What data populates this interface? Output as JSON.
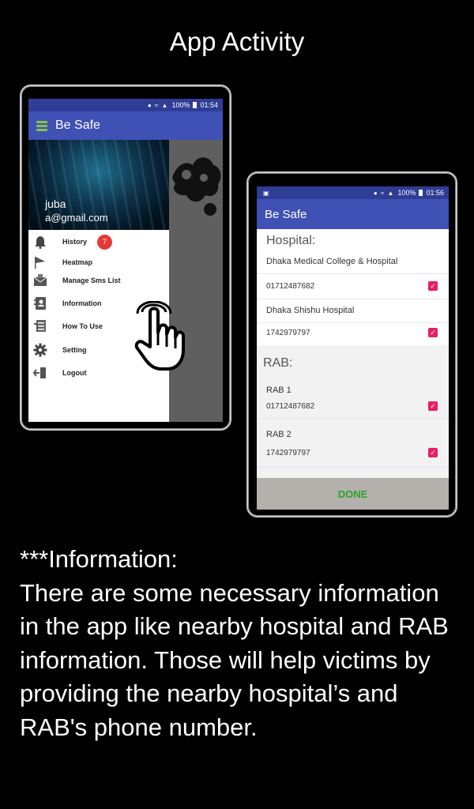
{
  "page": {
    "title": "App Activity"
  },
  "left_device": {
    "status": {
      "time": "01:54",
      "battery": "100%"
    },
    "appbar": {
      "title": "Be Safe",
      "menu_icon": "hamburger-icon",
      "menu_icon_color": "#8bc34a"
    },
    "drawer": {
      "user_name": "juba",
      "user_email": "a@gmail.com",
      "items": [
        {
          "label": "History",
          "icon": "bell-icon",
          "badge": "7"
        },
        {
          "label": "Heatmap",
          "icon": "map-pin-icon"
        },
        {
          "label": "Manage Sms List",
          "icon": "mail-icon"
        },
        {
          "label": "Information",
          "icon": "contacts-book-icon"
        },
        {
          "label": "How To Use",
          "icon": "list-help-icon"
        },
        {
          "label": "Setting",
          "icon": "gear-icon"
        },
        {
          "label": "Logout",
          "icon": "logout-icon"
        }
      ]
    },
    "pointer_icon": "pointing-hand-icon"
  },
  "right_device": {
    "status": {
      "time": "01:56",
      "battery": "100%"
    },
    "appbar": {
      "title": "Be Safe"
    },
    "hospital_section": {
      "title": "Hospital:",
      "entries": [
        {
          "name": "Dhaka Medical College & Hospital",
          "phone": "01712487682",
          "checked": true
        },
        {
          "name": "Dhaka Shishu Hospital",
          "phone": "1742979797",
          "checked": true
        }
      ]
    },
    "rab_section": {
      "title": "RAB:",
      "entries": [
        {
          "name": "RAB 1",
          "phone": "01712487682",
          "checked": true
        },
        {
          "name": "RAB 2",
          "phone": "1742979797",
          "checked": true
        }
      ]
    },
    "done_label": "DONE"
  },
  "description": {
    "heading": "***Information:",
    "body": "There are some necessary information in the  app like nearby hospital and RAB information. Those will help victims by providing the nearby hospital’s and RAB's phone number."
  },
  "colors": {
    "appbar": "#3f51b5",
    "statusbar": "#2f3d95",
    "badge": "#e53935",
    "checkbox": "#e91e63",
    "done_text": "#2aa52a",
    "done_bar": "#b4b0ab"
  }
}
